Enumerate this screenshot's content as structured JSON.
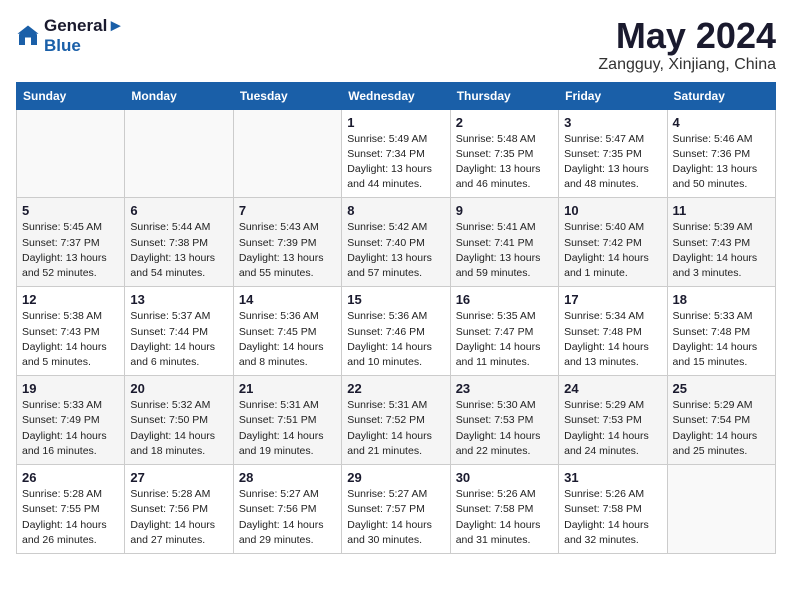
{
  "header": {
    "logo_line1": "General",
    "logo_line2": "Blue",
    "month": "May 2024",
    "location": "Zangguy, Xinjiang, China"
  },
  "days_of_week": [
    "Sunday",
    "Monday",
    "Tuesday",
    "Wednesday",
    "Thursday",
    "Friday",
    "Saturday"
  ],
  "weeks": [
    [
      {
        "day": "",
        "info": ""
      },
      {
        "day": "",
        "info": ""
      },
      {
        "day": "",
        "info": ""
      },
      {
        "day": "1",
        "info": "Sunrise: 5:49 AM\nSunset: 7:34 PM\nDaylight: 13 hours\nand 44 minutes."
      },
      {
        "day": "2",
        "info": "Sunrise: 5:48 AM\nSunset: 7:35 PM\nDaylight: 13 hours\nand 46 minutes."
      },
      {
        "day": "3",
        "info": "Sunrise: 5:47 AM\nSunset: 7:35 PM\nDaylight: 13 hours\nand 48 minutes."
      },
      {
        "day": "4",
        "info": "Sunrise: 5:46 AM\nSunset: 7:36 PM\nDaylight: 13 hours\nand 50 minutes."
      }
    ],
    [
      {
        "day": "5",
        "info": "Sunrise: 5:45 AM\nSunset: 7:37 PM\nDaylight: 13 hours\nand 52 minutes."
      },
      {
        "day": "6",
        "info": "Sunrise: 5:44 AM\nSunset: 7:38 PM\nDaylight: 13 hours\nand 54 minutes."
      },
      {
        "day": "7",
        "info": "Sunrise: 5:43 AM\nSunset: 7:39 PM\nDaylight: 13 hours\nand 55 minutes."
      },
      {
        "day": "8",
        "info": "Sunrise: 5:42 AM\nSunset: 7:40 PM\nDaylight: 13 hours\nand 57 minutes."
      },
      {
        "day": "9",
        "info": "Sunrise: 5:41 AM\nSunset: 7:41 PM\nDaylight: 13 hours\nand 59 minutes."
      },
      {
        "day": "10",
        "info": "Sunrise: 5:40 AM\nSunset: 7:42 PM\nDaylight: 14 hours\nand 1 minute."
      },
      {
        "day": "11",
        "info": "Sunrise: 5:39 AM\nSunset: 7:43 PM\nDaylight: 14 hours\nand 3 minutes."
      }
    ],
    [
      {
        "day": "12",
        "info": "Sunrise: 5:38 AM\nSunset: 7:43 PM\nDaylight: 14 hours\nand 5 minutes."
      },
      {
        "day": "13",
        "info": "Sunrise: 5:37 AM\nSunset: 7:44 PM\nDaylight: 14 hours\nand 6 minutes."
      },
      {
        "day": "14",
        "info": "Sunrise: 5:36 AM\nSunset: 7:45 PM\nDaylight: 14 hours\nand 8 minutes."
      },
      {
        "day": "15",
        "info": "Sunrise: 5:36 AM\nSunset: 7:46 PM\nDaylight: 14 hours\nand 10 minutes."
      },
      {
        "day": "16",
        "info": "Sunrise: 5:35 AM\nSunset: 7:47 PM\nDaylight: 14 hours\nand 11 minutes."
      },
      {
        "day": "17",
        "info": "Sunrise: 5:34 AM\nSunset: 7:48 PM\nDaylight: 14 hours\nand 13 minutes."
      },
      {
        "day": "18",
        "info": "Sunrise: 5:33 AM\nSunset: 7:48 PM\nDaylight: 14 hours\nand 15 minutes."
      }
    ],
    [
      {
        "day": "19",
        "info": "Sunrise: 5:33 AM\nSunset: 7:49 PM\nDaylight: 14 hours\nand 16 minutes."
      },
      {
        "day": "20",
        "info": "Sunrise: 5:32 AM\nSunset: 7:50 PM\nDaylight: 14 hours\nand 18 minutes."
      },
      {
        "day": "21",
        "info": "Sunrise: 5:31 AM\nSunset: 7:51 PM\nDaylight: 14 hours\nand 19 minutes."
      },
      {
        "day": "22",
        "info": "Sunrise: 5:31 AM\nSunset: 7:52 PM\nDaylight: 14 hours\nand 21 minutes."
      },
      {
        "day": "23",
        "info": "Sunrise: 5:30 AM\nSunset: 7:53 PM\nDaylight: 14 hours\nand 22 minutes."
      },
      {
        "day": "24",
        "info": "Sunrise: 5:29 AM\nSunset: 7:53 PM\nDaylight: 14 hours\nand 24 minutes."
      },
      {
        "day": "25",
        "info": "Sunrise: 5:29 AM\nSunset: 7:54 PM\nDaylight: 14 hours\nand 25 minutes."
      }
    ],
    [
      {
        "day": "26",
        "info": "Sunrise: 5:28 AM\nSunset: 7:55 PM\nDaylight: 14 hours\nand 26 minutes."
      },
      {
        "day": "27",
        "info": "Sunrise: 5:28 AM\nSunset: 7:56 PM\nDaylight: 14 hours\nand 27 minutes."
      },
      {
        "day": "28",
        "info": "Sunrise: 5:27 AM\nSunset: 7:56 PM\nDaylight: 14 hours\nand 29 minutes."
      },
      {
        "day": "29",
        "info": "Sunrise: 5:27 AM\nSunset: 7:57 PM\nDaylight: 14 hours\nand 30 minutes."
      },
      {
        "day": "30",
        "info": "Sunrise: 5:26 AM\nSunset: 7:58 PM\nDaylight: 14 hours\nand 31 minutes."
      },
      {
        "day": "31",
        "info": "Sunrise: 5:26 AM\nSunset: 7:58 PM\nDaylight: 14 hours\nand 32 minutes."
      },
      {
        "day": "",
        "info": ""
      }
    ]
  ]
}
